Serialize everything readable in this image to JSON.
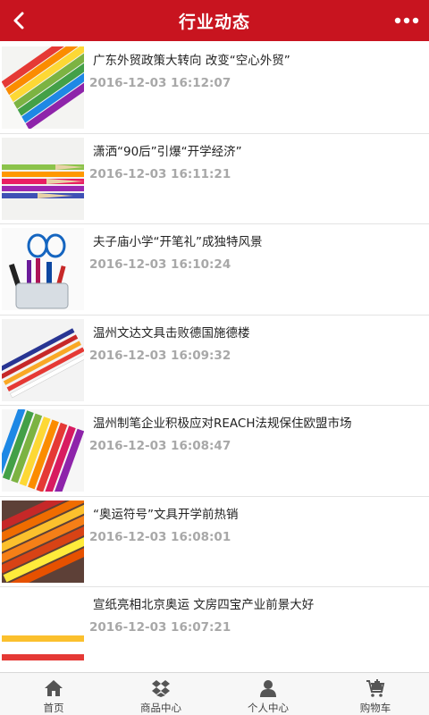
{
  "header": {
    "title": "行业动态",
    "bg_color": "#c8141f"
  },
  "news": [
    {
      "title": "广东外贸政策大转向 改变“空心外贸”",
      "date": "2016-12-03 16:12:07",
      "thumb": "colored-pencils-fan"
    },
    {
      "title": "潇洒“90后”引爆“开学经济”",
      "date": "2016-12-03 16:11:21",
      "thumb": "colored-pencils-horizontal"
    },
    {
      "title": "夫子庙小学“开笔礼”成独特风景",
      "date": "2016-12-03 16:10:24",
      "thumb": "pen-holder-scissors"
    },
    {
      "title": "温州文达文具击败德国施德楼",
      "date": "2016-12-03 16:09:32",
      "thumb": "pencils-diagonal"
    },
    {
      "title": "温州制笔企业积极应对REACH法规保住欧盟市场",
      "date": "2016-12-03 16:08:47",
      "thumb": "colored-pencils-tips"
    },
    {
      "title": "“奥运符号”文具开学前热销",
      "date": "2016-12-03 16:08:01",
      "thumb": "colored-pencils-stack"
    },
    {
      "title": "宣纸亮相北京奥运 文房四宝产业前景大好",
      "date": "2016-12-03 16:07:21",
      "thumb": "two-pencils"
    }
  ],
  "tabbar": {
    "home": "首页",
    "products": "商品中心",
    "profile": "个人中心",
    "cart": "购物车"
  }
}
